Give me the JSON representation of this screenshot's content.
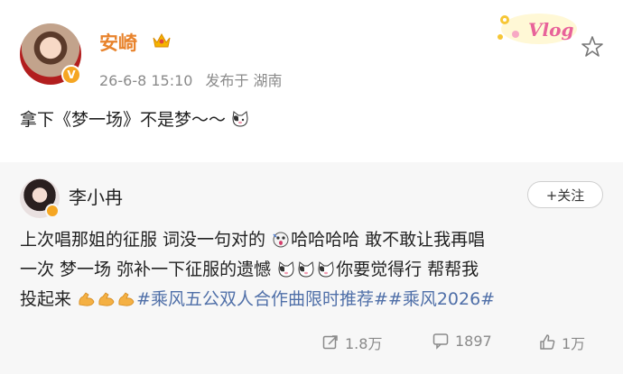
{
  "post": {
    "author": "安崎",
    "time": "26-6-8 15:10",
    "location": "发布于 湖南",
    "text": "拿下《梦一场》不是梦～～"
  },
  "repost": {
    "author": "李小冉",
    "follow_label": "+关注",
    "line1": "上次唱那姐的征服 词没一句对的",
    "line1b": "哈哈哈哈 敢不敢让我再唱",
    "line2a": "一次 梦一场 弥补一下征服的遗憾",
    "line2b": "你要觉得行 帮帮我",
    "line3a": "投起来",
    "hashtag1": "#乘风五公双人合作曲限时推荐#",
    "hashtag2": "#乘风2026#"
  },
  "actions": {
    "repost_count": "1.8万",
    "comment_count": "1897",
    "like_count": "1万"
  },
  "colors": {
    "name_highlight": "#e8832c",
    "hashtag": "#4f6fa8",
    "verified_badge": "#f5a623",
    "repost_bg": "#f7f7f7"
  },
  "icons": [
    "crown-icon",
    "vlog-sticker-icon",
    "star-icon",
    "cat-emoji-icon",
    "surprised-emoji-icon",
    "muscle-emoji-icon",
    "repost-icon",
    "comment-icon",
    "like-icon",
    "verified-icon"
  ]
}
